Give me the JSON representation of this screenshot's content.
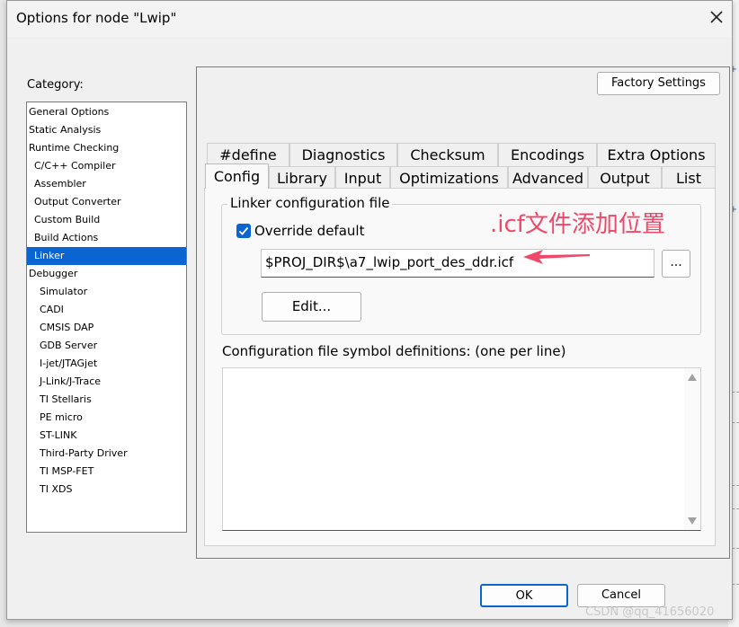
{
  "dialog": {
    "title": "Options for node \"Lwip\"",
    "close_icon": "close-icon"
  },
  "category": {
    "label": "Category:",
    "selected": "Linker",
    "items": [
      "General Options",
      "Static Analysis",
      "Runtime Checking",
      "C/C++ Compiler",
      "Assembler",
      "Output Converter",
      "Custom Build",
      "Build Actions",
      "Linker",
      "Debugger",
      "Simulator",
      "CADI",
      "CMSIS DAP",
      "GDB Server",
      "I-jet/JTAGjet",
      "J-Link/J-Trace",
      "TI Stellaris",
      "PE micro",
      "ST-LINK",
      "Third-Party Driver",
      "TI MSP-FET",
      "TI XDS"
    ]
  },
  "factory_settings": "Factory Settings",
  "tabs_back": [
    "#define",
    "Diagnostics",
    "Checksum",
    "Encodings",
    "Extra Options"
  ],
  "tabs_front": [
    "Config",
    "Library",
    "Input",
    "Optimizations",
    "Advanced",
    "Output",
    "List"
  ],
  "active_tab": "Config",
  "linker_config": {
    "group_label": "Linker configuration file",
    "override_label": "Override default",
    "override_checked": true,
    "file_path": "$PROJ_DIR$\\a7_lwip_port_des_ddr.icf",
    "browse_label": "...",
    "edit_label": "Edit..."
  },
  "annotation": {
    "text": ".icf文件添加位置",
    "color": "#f04868"
  },
  "symbols": {
    "label": "Configuration file symbol definitions: (one per line)",
    "value": ""
  },
  "footer": {
    "ok_label": "OK",
    "cancel_label": "Cancel"
  },
  "watermark": "CSDN @qq_41656020",
  "colors": {
    "accent": "#0a64d2",
    "dialog_bg": "#f0f0f0"
  }
}
